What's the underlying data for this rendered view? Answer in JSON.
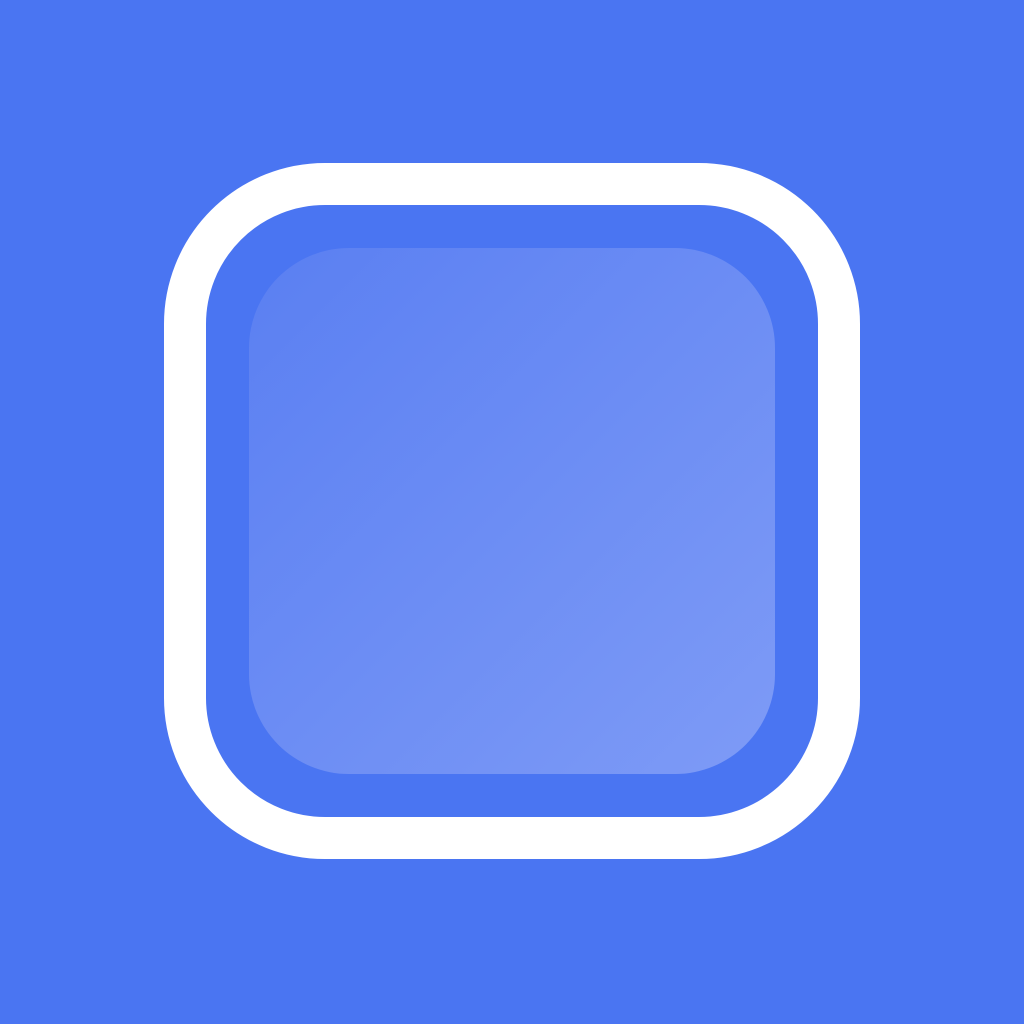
{
  "icon": {
    "name": "rounded-square-icon",
    "colors": {
      "background": "#4A75F2",
      "outline": "#FFFFFF",
      "inner_gap": "#4A75F2",
      "fill_gradient_start": "#5A7FF2",
      "fill_gradient_end": "#7E9BF6"
    }
  }
}
